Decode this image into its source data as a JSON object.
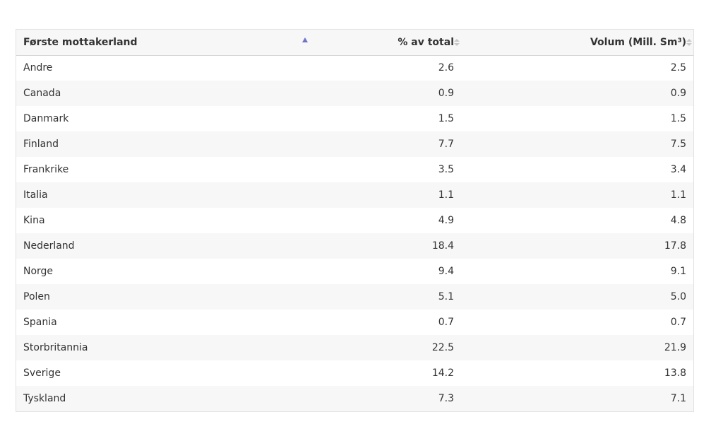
{
  "table": {
    "headers": {
      "country": "Første mottakerland",
      "percent": "% av total",
      "volume": "Volum (Mill. Sm³)"
    },
    "sort": {
      "column": "country",
      "direction": "ascending"
    },
    "rows": [
      {
        "country": "Andre",
        "percent": "2.6",
        "volume": "2.5"
      },
      {
        "country": "Canada",
        "percent": "0.9",
        "volume": "0.9"
      },
      {
        "country": "Danmark",
        "percent": "1.5",
        "volume": "1.5"
      },
      {
        "country": "Finland",
        "percent": "7.7",
        "volume": "7.5"
      },
      {
        "country": "Frankrike",
        "percent": "3.5",
        "volume": "3.4"
      },
      {
        "country": "Italia",
        "percent": "1.1",
        "volume": "1.1"
      },
      {
        "country": "Kina",
        "percent": "4.9",
        "volume": "4.8"
      },
      {
        "country": "Nederland",
        "percent": "18.4",
        "volume": "17.8"
      },
      {
        "country": "Norge",
        "percent": "9.4",
        "volume": "9.1"
      },
      {
        "country": "Polen",
        "percent": "5.1",
        "volume": "5.0"
      },
      {
        "country": "Spania",
        "percent": "0.7",
        "volume": "0.7"
      },
      {
        "country": "Storbritannia",
        "percent": "22.5",
        "volume": "21.9"
      },
      {
        "country": "Sverige",
        "percent": "14.2",
        "volume": "13.8"
      },
      {
        "country": "Tyskland",
        "percent": "7.3",
        "volume": "7.1"
      }
    ]
  },
  "colors": {
    "sort_active": "#6f74c9",
    "sort_inactive": "#c8c8c8",
    "stripe": "#f7f7f7"
  },
  "icons": {
    "sort_asc": "triangle-up-icon",
    "sort_none": "sort-both-icon"
  }
}
